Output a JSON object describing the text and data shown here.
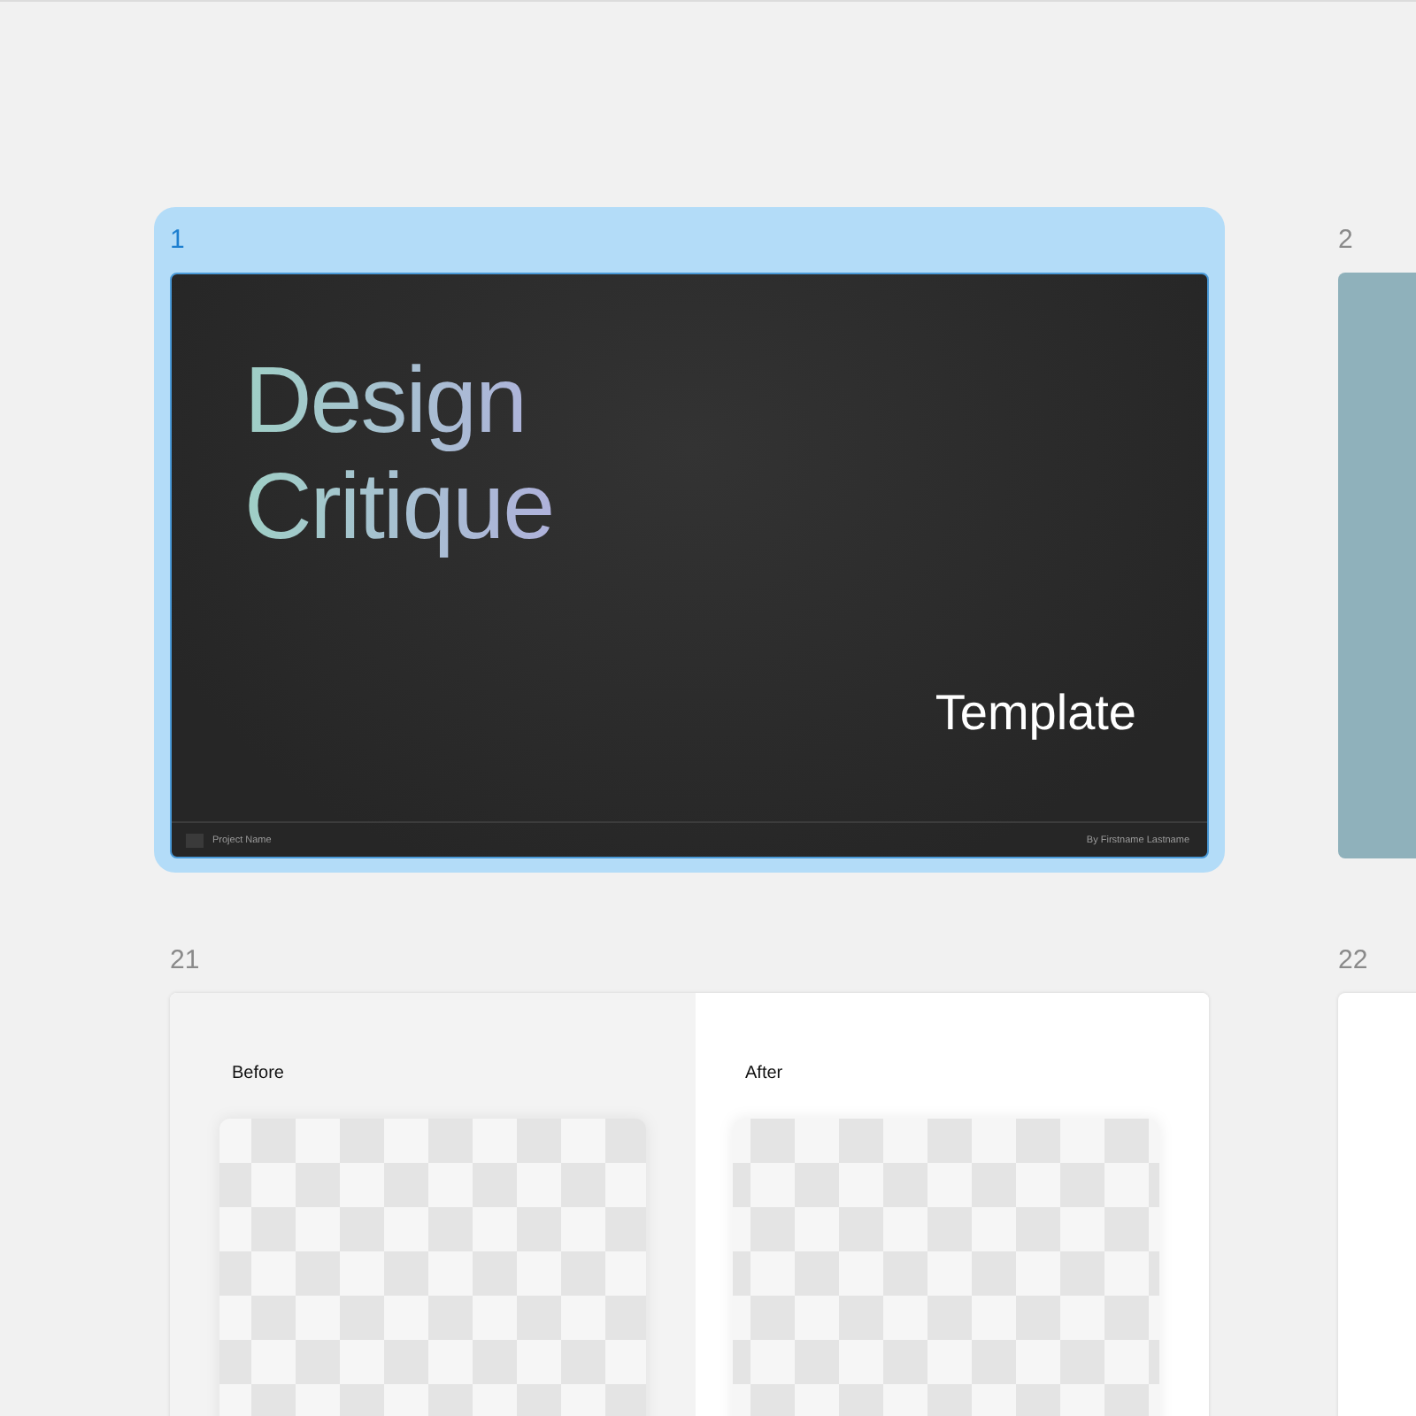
{
  "slides": [
    {
      "number": "1",
      "selected": true,
      "kind": "title",
      "title": "Design Critique",
      "subtitle": "Template",
      "footer_left": "Project Name",
      "footer_right": "By Firstname Lastname"
    },
    {
      "number": "2",
      "selected": false,
      "kind": "solid"
    },
    {
      "number": "21",
      "selected": false,
      "kind": "before_after",
      "left_label": "Before",
      "right_label": "After"
    },
    {
      "number": "22",
      "selected": false,
      "kind": "blank"
    }
  ]
}
